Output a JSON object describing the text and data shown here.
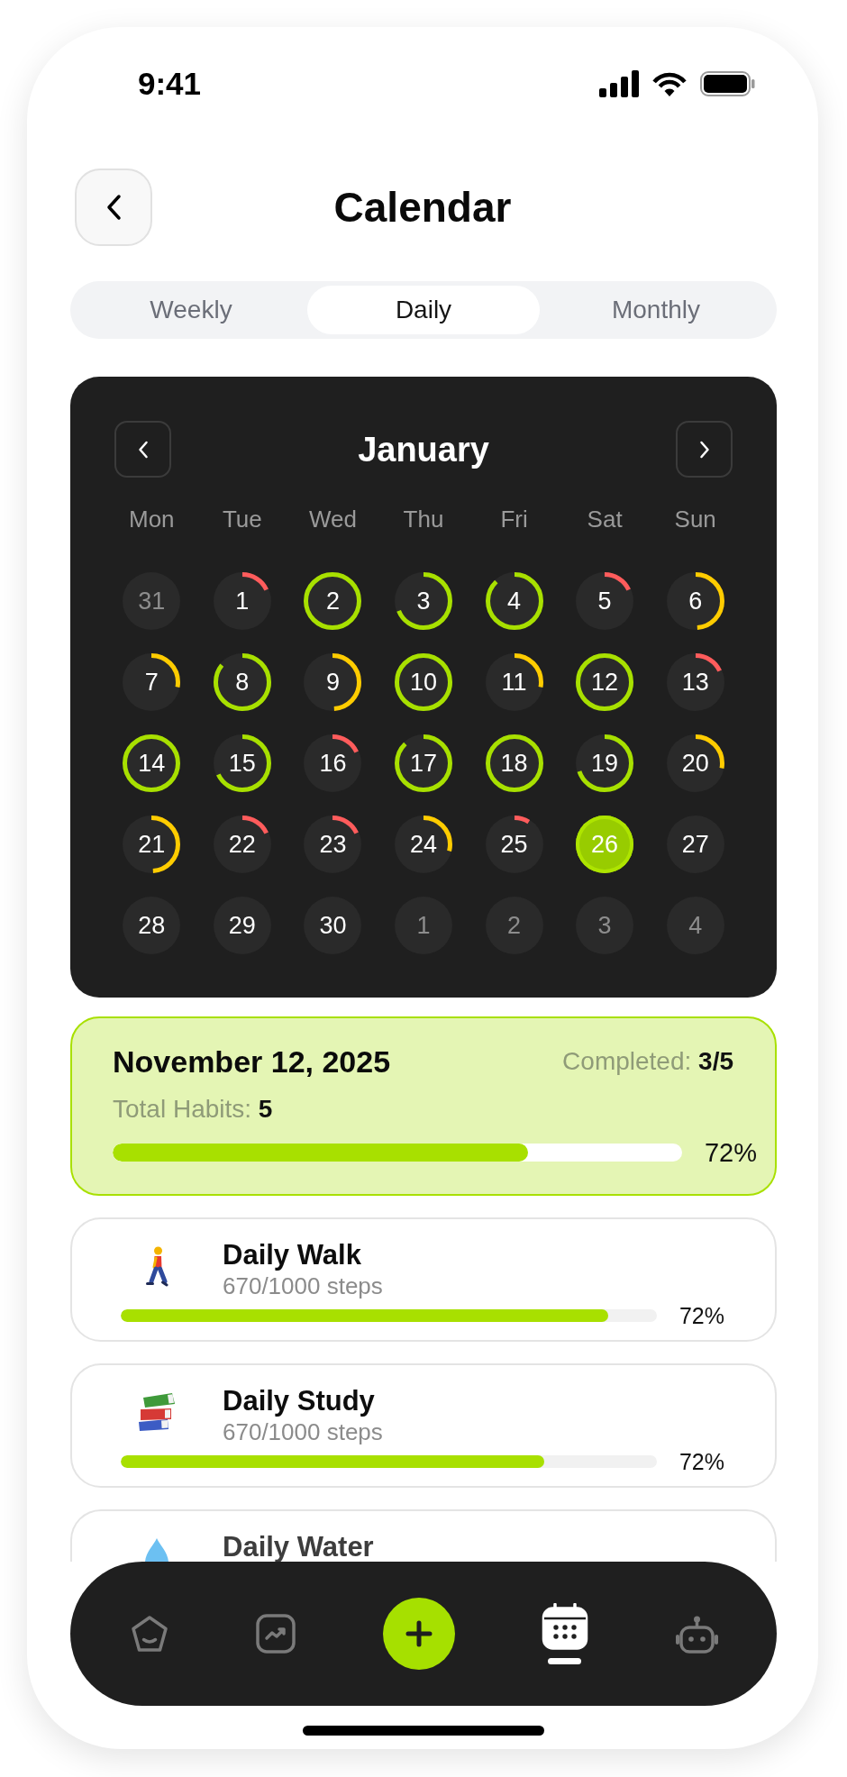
{
  "status_bar": {
    "time": "9:41"
  },
  "header": {
    "title": "Calendar"
  },
  "view_tabs": [
    {
      "label": "Weekly",
      "selected": false
    },
    {
      "label": "Daily",
      "selected": true
    },
    {
      "label": "Monthly",
      "selected": false
    }
  ],
  "calendar": {
    "month": "January",
    "weekdays": [
      "Mon",
      "Tue",
      "Wed",
      "Thu",
      "Fri",
      "Sat",
      "Sun"
    ],
    "days": [
      {
        "day": "31",
        "muted": true,
        "selected": false
      },
      {
        "day": "1",
        "muted": false,
        "selected": false,
        "level": 0.18,
        "color": "#ff5c5c"
      },
      {
        "day": "2",
        "muted": false,
        "selected": false,
        "level": 1,
        "color": "#a8e000"
      },
      {
        "day": "3",
        "muted": false,
        "selected": false,
        "level": 0.69,
        "color": "#a8e000"
      },
      {
        "day": "4",
        "muted": false,
        "selected": false,
        "level": 0.88,
        "color": "#a8e000"
      },
      {
        "day": "5",
        "muted": false,
        "selected": false,
        "level": 0.18,
        "color": "#ff5c5c"
      },
      {
        "day": "6",
        "muted": false,
        "selected": false,
        "level": 0.49,
        "color": "#ffcc00"
      },
      {
        "day": "7",
        "muted": false,
        "selected": false,
        "level": 0.28,
        "color": "#ffcc00"
      },
      {
        "day": "8",
        "muted": false,
        "selected": false,
        "level": 0.86,
        "color": "#a8e000"
      },
      {
        "day": "9",
        "muted": false,
        "selected": false,
        "level": 0.49,
        "color": "#ffcc00"
      },
      {
        "day": "10",
        "muted": false,
        "selected": false,
        "level": 1,
        "color": "#a8e000"
      },
      {
        "day": "11",
        "muted": false,
        "selected": false,
        "level": 0.28,
        "color": "#ffcc00"
      },
      {
        "day": "12",
        "muted": false,
        "selected": false,
        "level": 1,
        "color": "#a8e000"
      },
      {
        "day": "13",
        "muted": false,
        "selected": false,
        "level": 0.18,
        "color": "#ff5c5c"
      },
      {
        "day": "14",
        "muted": false,
        "selected": false,
        "level": 1,
        "color": "#a8e000"
      },
      {
        "day": "15",
        "muted": false,
        "selected": false,
        "level": 0.68,
        "color": "#a8e000"
      },
      {
        "day": "16",
        "muted": false,
        "selected": false,
        "level": 0.18,
        "color": "#ff5c5c"
      },
      {
        "day": "17",
        "muted": false,
        "selected": false,
        "level": 0.88,
        "color": "#a8e000"
      },
      {
        "day": "18",
        "muted": false,
        "selected": false,
        "level": 1,
        "color": "#a8e000"
      },
      {
        "day": "19",
        "muted": false,
        "selected": false,
        "level": 0.7,
        "color": "#a8e000"
      },
      {
        "day": "20",
        "muted": false,
        "selected": false,
        "level": 0.28,
        "color": "#ffcc00"
      },
      {
        "day": "21",
        "muted": false,
        "selected": false,
        "level": 0.49,
        "color": "#ffcc00"
      },
      {
        "day": "22",
        "muted": false,
        "selected": false,
        "level": 0.18,
        "color": "#ff5c5c"
      },
      {
        "day": "23",
        "muted": false,
        "selected": false,
        "level": 0.18,
        "color": "#ff5c5c"
      },
      {
        "day": "24",
        "muted": false,
        "selected": false,
        "level": 0.29,
        "color": "#ffcc00"
      },
      {
        "day": "25",
        "muted": false,
        "selected": false,
        "level": 0.09,
        "color": "#ff5c5c"
      },
      {
        "day": "26",
        "muted": false,
        "selected": true
      },
      {
        "day": "27",
        "muted": false,
        "selected": false
      },
      {
        "day": "28",
        "muted": false,
        "selected": false
      },
      {
        "day": "29",
        "muted": false,
        "selected": false
      },
      {
        "day": "30",
        "muted": false,
        "selected": false
      },
      {
        "day": "1",
        "muted": true,
        "selected": false
      },
      {
        "day": "2",
        "muted": true,
        "selected": false
      },
      {
        "day": "3",
        "muted": true,
        "selected": false
      },
      {
        "day": "4",
        "muted": true,
        "selected": false
      }
    ]
  },
  "summary": {
    "date": "November 12, 2025",
    "completed": "Completed: **3/5**",
    "total": "Total Habits: **5**",
    "level": 0.73,
    "percent": "72%"
  },
  "habits": [
    {
      "title": "Daily Walk",
      "detail": "670/1000 steps",
      "level": 0.91,
      "percent": "72%"
    },
    {
      "title": "Daily Study",
      "detail": "670/1000 steps",
      "level": 0.79,
      "percent": "72%"
    },
    {
      "title": "Daily Water"
    }
  ],
  "bottom_nav": {
    "tabs": [
      {
        "selected": false
      },
      {
        "selected": false
      },
      {
        "selected": true
      },
      {
        "selected": false
      }
    ]
  }
}
